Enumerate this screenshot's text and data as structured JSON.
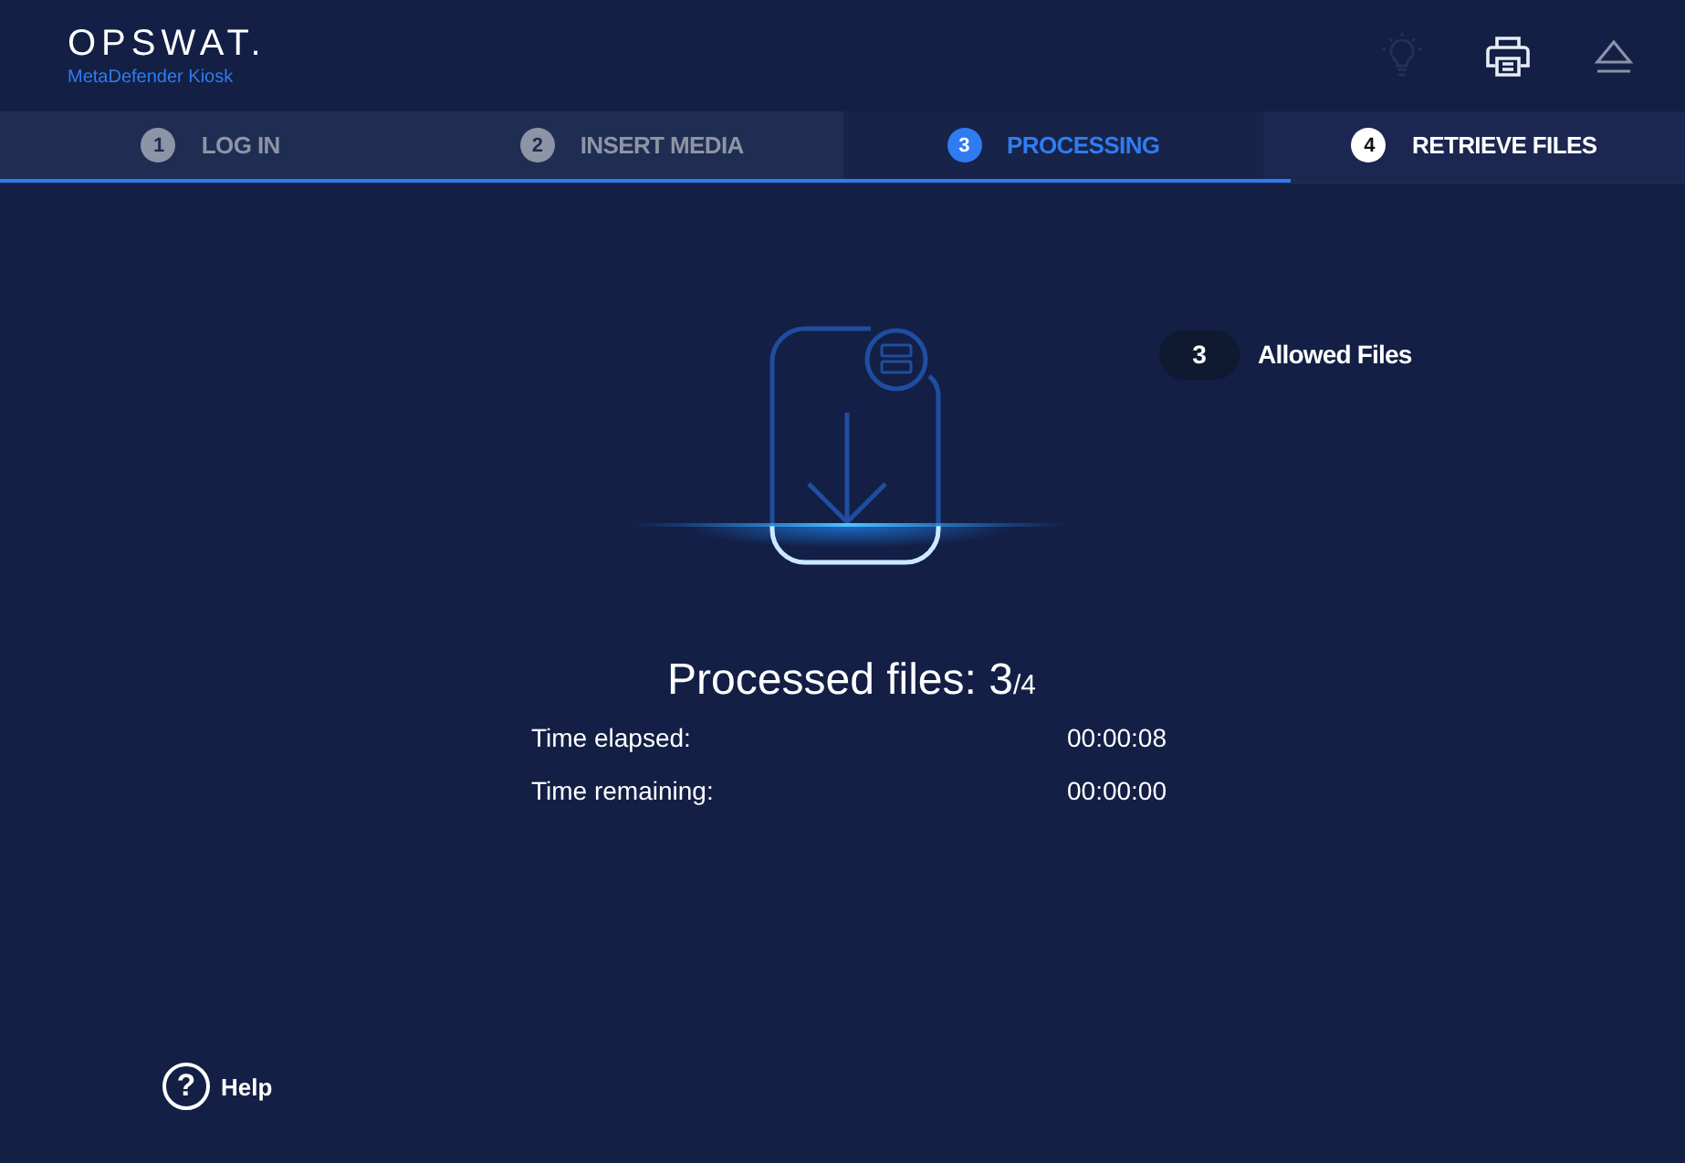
{
  "header": {
    "logo": "OPSWAT.",
    "product": "MetaDefender Kiosk"
  },
  "toolbar": [
    {
      "kind": "bulb",
      "disabled": true
    },
    {
      "kind": "printer",
      "disabled": false
    },
    {
      "kind": "eject",
      "disabled": false
    }
  ],
  "steps": [
    {
      "number": "1",
      "label": "LOG IN",
      "completed": true,
      "selected": false
    },
    {
      "number": "2",
      "label": "INSERT MEDIA",
      "completed": true,
      "selected": false
    },
    {
      "number": "3",
      "label": "PROCESSING",
      "completed": false,
      "selected": true
    },
    {
      "number": "4",
      "label": "RETRIEVE FILES",
      "completed": false,
      "selected": false
    }
  ],
  "progress": {
    "level": 0.766
  },
  "allowed": {
    "count": "3",
    "label": "Allowed Files"
  },
  "processed": "Processed files: 3$_{/4}$",
  "times": [
    {
      "label": "Time elapsed:",
      "value": "00:00:08"
    },
    {
      "label": "Time remaining:",
      "value": "00:00:00"
    }
  ],
  "help": {
    "icon": "?",
    "label": "Help"
  }
}
